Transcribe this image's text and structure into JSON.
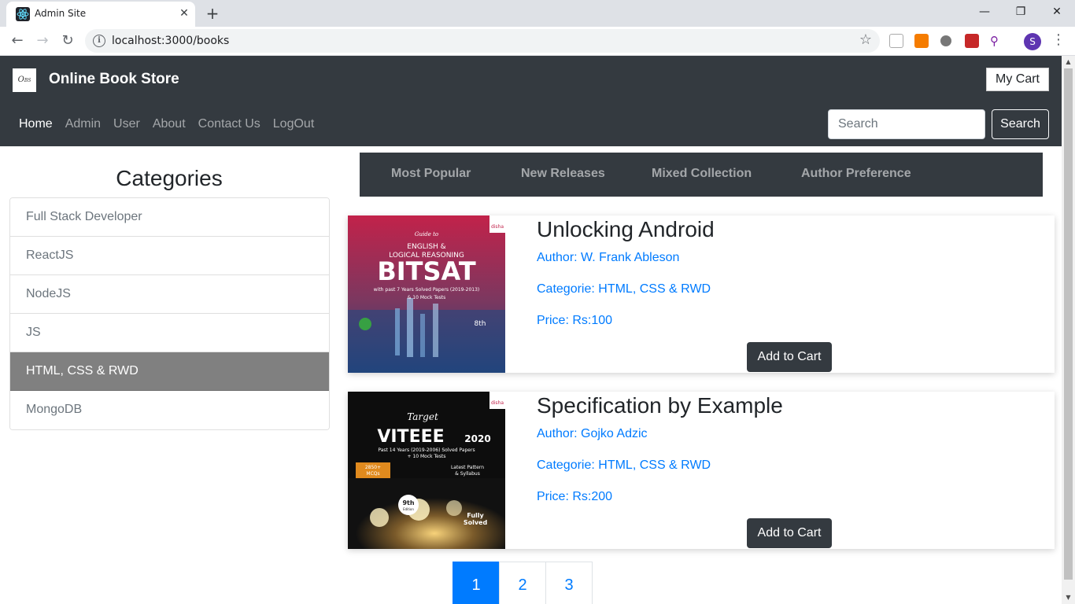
{
  "browser": {
    "tab_title": "Admin Site",
    "tab_close": "✕",
    "new_tab": "+",
    "url": "localhost:3000/books",
    "profile_initial": "S"
  },
  "header": {
    "brand": "Online Book Store",
    "cart_label": "My Cart",
    "nav": [
      "Home",
      "Admin",
      "User",
      "About",
      "Contact Us",
      "LogOut"
    ],
    "search_placeholder": "Search",
    "search_button": "Search"
  },
  "sidebar": {
    "title": "Categories",
    "items": [
      "Full Stack Developer",
      "ReactJS",
      "NodeJS",
      "JS",
      "HTML, CSS & RWD",
      "MongoDB"
    ],
    "active_index": 4
  },
  "filters": [
    "Most Popular",
    "New Releases",
    "Mixed Collection",
    "Author Preference"
  ],
  "books": [
    {
      "title": "Unlocking Android",
      "author": "Author: W. Frank Ableson",
      "category": "Categorie: HTML, CSS & RWD",
      "price": "Price: Rs:100",
      "button": "Add to Cart",
      "cover": {
        "top": "Guide to",
        "line1": "ENGLISH &",
        "line2": "LOGICAL REASONING",
        "big": "BITSAT",
        "sub": "with past 7 Years Solved Papers (2019-2013)",
        "sub2": "& 10 Mock Tests",
        "edition": "8th",
        "brand": "disha"
      }
    },
    {
      "title": "Specification by Example",
      "author": "Author: Gojko Adzic",
      "category": "Categorie: HTML, CSS & RWD",
      "price": "Price: Rs:200",
      "button": "Add to Cart",
      "cover": {
        "top": "Target",
        "big": "VITEEE",
        "year": "2020",
        "sub": "Past 14 Years (2019-2006) Solved Papers",
        "sub2": "+ 10 Mock Tests",
        "badge": "2850+",
        "badge2": "MCQs",
        "pattern": "Latest Pattern",
        "pattern2": "& Syllabus",
        "edition": "9th",
        "edition2": "Edition",
        "solved": "Fully",
        "solved2": "Solved",
        "brand": "disha"
      }
    }
  ],
  "pagination": [
    "1",
    "2",
    "3"
  ],
  "colors": {
    "navbar": "#343a40",
    "link": "#007bff",
    "active_category": "#808080",
    "active_page": "#007bff"
  }
}
